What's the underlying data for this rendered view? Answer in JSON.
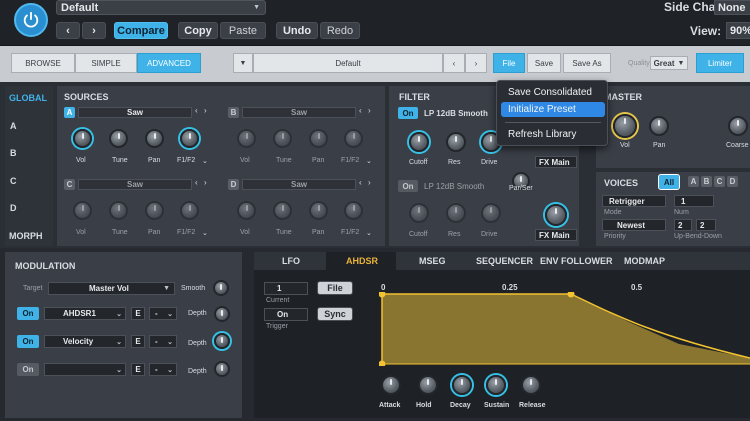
{
  "topbar": {
    "preset_name": "Default",
    "compare": "Compare",
    "copy": "Copy",
    "paste": "Paste",
    "undo": "Undo",
    "redo": "Redo",
    "side_chain_label": "Side Chain:",
    "side_chain_value": "None",
    "view_label": "View:",
    "view_value": "90%"
  },
  "toolbar": {
    "tabs": [
      "BROWSE",
      "SIMPLE",
      "ADVANCED"
    ],
    "preset": "Default",
    "file": "File",
    "save": "Save",
    "save_as": "Save As",
    "quality_label": "Quality",
    "quality_value": "Great",
    "limiter": "Limiter"
  },
  "menu": {
    "items": [
      "Save Consolidated",
      "Initialize Preset",
      "Refresh Library"
    ],
    "highlighted": "Initialize Preset"
  },
  "nav": {
    "items": [
      "GLOBAL",
      "A",
      "B",
      "C",
      "D",
      "MORPH"
    ]
  },
  "sources": {
    "title": "SOURCES",
    "oscillators": [
      {
        "letter": "A",
        "wave": "Saw",
        "active": true,
        "knobs": [
          "Vol",
          "Tune",
          "Pan",
          "F1/F2"
        ]
      },
      {
        "letter": "B",
        "wave": "Saw",
        "active": false,
        "knobs": [
          "Vol",
          "Tune",
          "Pan",
          "F1/F2"
        ]
      },
      {
        "letter": "C",
        "wave": "Saw",
        "active": false,
        "knobs": [
          "Vol",
          "Tune",
          "Pan",
          "F1/F2"
        ]
      },
      {
        "letter": "D",
        "wave": "Saw",
        "active": false,
        "knobs": [
          "Vol",
          "Tune",
          "Pan",
          "F1/F2"
        ]
      }
    ]
  },
  "filter": {
    "title": "FILTER",
    "on": "On",
    "type1": "LP 12dB Smooth",
    "type2": "LP 12dB Smooth",
    "knobs": [
      "Cutoff",
      "Res",
      "Drive"
    ],
    "fx_main": "FX Main",
    "par_ser": "Par/Ser"
  },
  "master": {
    "title": "MASTER",
    "knobs": [
      "Vol",
      "Pan",
      "Coarse"
    ]
  },
  "voices": {
    "title": "VOICES",
    "all": "All",
    "letters": [
      "A",
      "B",
      "C",
      "D"
    ],
    "retrigger": "Retrigger",
    "mode_label": "Mode",
    "num_value": "1",
    "num_label": "Num",
    "newest": "Newest",
    "priority_label": "Priority",
    "up_value": "2",
    "down_value": "2",
    "updown_label": "Up-Bend-Down"
  },
  "modulation": {
    "title": "MODULATION",
    "target_label": "Target",
    "target_value": "Master Vol",
    "smooth_label": "Smooth",
    "rows": [
      {
        "on": "On",
        "source": "AHDSR1",
        "depth": "Depth",
        "active": true
      },
      {
        "on": "On",
        "source": "Velocity",
        "depth": "Depth",
        "active": true
      },
      {
        "on": "On",
        "source": "",
        "depth": "Depth",
        "active": false
      }
    ],
    "e_label": "E",
    "dash": "-"
  },
  "env_tabs": [
    "LFO",
    "AHDSR",
    "MSEG",
    "SEQUENCER",
    "ENV FOLLOWER",
    "MODMAP"
  ],
  "envelope": {
    "current_value": "1",
    "current_label": "Current",
    "file": "File",
    "trigger_value": "On",
    "trigger_label": "Trigger",
    "sync": "Sync",
    "ticks": [
      "0",
      "0.25",
      "0.5"
    ],
    "knobs": [
      "Attack",
      "Hold",
      "Decay",
      "Sustain",
      "Release"
    ]
  },
  "colors": {
    "accent": "#3fb3e8",
    "envelope_line": "#f2c230",
    "envelope_fill": "#8a7530"
  }
}
